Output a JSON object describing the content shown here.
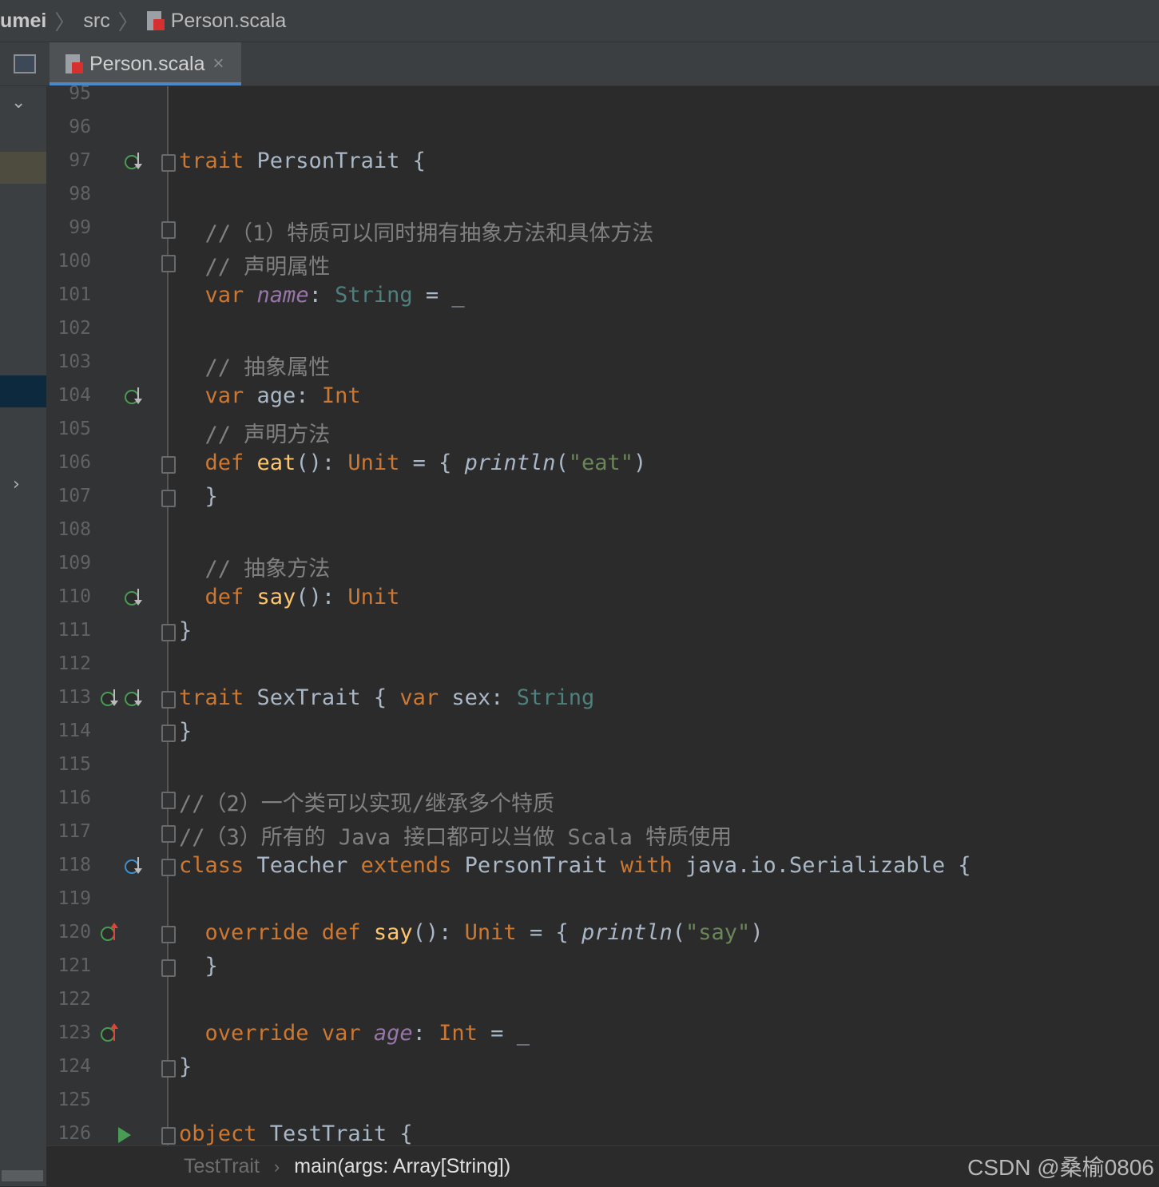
{
  "breadcrumb": {
    "project": "umei",
    "folder": "src",
    "file": "Person.scala",
    "file_icon": "scala-file-icon"
  },
  "tabs": [
    {
      "label": "Person.scala",
      "close": "×",
      "active": true
    }
  ],
  "gutter_icons": {
    "implemented": "implemented-down-icon",
    "overriding": "overriding-up-icon",
    "class_impl": "class-implemented-icon",
    "run": "run-icon"
  },
  "editor_lines": [
    {
      "n": "95"
    },
    {
      "n": "96"
    },
    {
      "n": "97"
    },
    {
      "n": "98"
    },
    {
      "n": "99"
    },
    {
      "n": "100"
    },
    {
      "n": "101"
    },
    {
      "n": "102"
    },
    {
      "n": "103"
    },
    {
      "n": "104"
    },
    {
      "n": "105"
    },
    {
      "n": "106"
    },
    {
      "n": "107"
    },
    {
      "n": "108"
    },
    {
      "n": "109"
    },
    {
      "n": "110"
    },
    {
      "n": "111"
    },
    {
      "n": "112"
    },
    {
      "n": "113"
    },
    {
      "n": "114"
    },
    {
      "n": "115"
    },
    {
      "n": "116"
    },
    {
      "n": "117"
    },
    {
      "n": "118"
    },
    {
      "n": "119"
    },
    {
      "n": "120"
    },
    {
      "n": "121"
    },
    {
      "n": "122"
    },
    {
      "n": "123"
    },
    {
      "n": "124"
    },
    {
      "n": "125"
    },
    {
      "n": "126"
    }
  ],
  "code": {
    "l97": {
      "kw": "trait",
      "rest": " PersonTrait {"
    },
    "l99": "  //（1）特质可以同时拥有抽象方法和具体方法",
    "l100": "  // 声明属性",
    "l101": {
      "kw": "  var",
      "sp": " ",
      "field": "name",
      "colon": ": ",
      "type": "String",
      "rest": " = _"
    },
    "l103": "  // 抽象属性",
    "l104": {
      "kw": "  var",
      "rest": " age: ",
      "type": "Int"
    },
    "l105": "  // 声明方法",
    "l106": {
      "kw": "  def",
      "sp": " ",
      "fn": "eat",
      "mid": "(): ",
      "type": "Unit",
      "eq": " = { ",
      "call": "println",
      "open": "(",
      "str": "\"eat\"",
      "close": ")"
    },
    "l107": "  }",
    "l109": "  // 抽象方法",
    "l110": {
      "kw": "  def",
      "sp": " ",
      "fn": "say",
      "mid": "(): ",
      "type": "Unit"
    },
    "l111": "}",
    "l113": {
      "kw": "trait",
      "mid": " SexTrait { ",
      "kw2": "var",
      "rest": " sex: ",
      "type": "String"
    },
    "l114": "}",
    "l116": "//（2）一个类可以实现/继承多个特质",
    "l117": "//（3）所有的 Java 接口都可以当做 Scala 特质使用",
    "l118": {
      "kw": "class",
      "a": " Teacher ",
      "kw2": "extends",
      "b": " PersonTrait ",
      "kw3": "with",
      "c": " java.io.Serializable {"
    },
    "l120": {
      "kw": "  override def",
      "sp": " ",
      "fn": "say",
      "mid": "(): ",
      "type": "Unit",
      "eq": " = { ",
      "call": "println",
      "open": "(",
      "str": "\"say\"",
      "close": ")"
    },
    "l121": "  }",
    "l123": {
      "kw": "  override var",
      "sp": " ",
      "field": "age",
      "colon": ": ",
      "type": "Int",
      "rest": " = _"
    },
    "l124": "}",
    "l126": {
      "kw": "object",
      "rest": " TestTrait {"
    }
  },
  "bottom_breadcrumb": {
    "object": "TestTrait",
    "sep": "›",
    "method": "main(args: Array[String])"
  },
  "watermark": "CSDN @桑榆0806",
  "colors": {
    "keyword": "#cc7832",
    "comment": "#808080",
    "string": "#6a8759",
    "type": "#4e807e",
    "field": "#9876aa",
    "function": "#ffc66d",
    "background": "#2b2b2b"
  }
}
